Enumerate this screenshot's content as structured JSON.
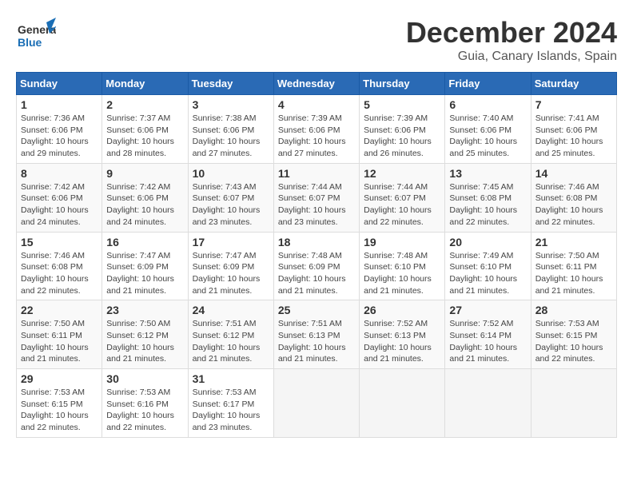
{
  "logo": {
    "line1": "General",
    "line2": "Blue"
  },
  "header": {
    "month": "December 2024",
    "location": "Guia, Canary Islands, Spain"
  },
  "weekdays": [
    "Sunday",
    "Monday",
    "Tuesday",
    "Wednesday",
    "Thursday",
    "Friday",
    "Saturday"
  ],
  "weeks": [
    [
      {
        "day": "1",
        "sunrise": "7:36 AM",
        "sunset": "6:06 PM",
        "daylight": "10 hours and 29 minutes."
      },
      {
        "day": "2",
        "sunrise": "7:37 AM",
        "sunset": "6:06 PM",
        "daylight": "10 hours and 28 minutes."
      },
      {
        "day": "3",
        "sunrise": "7:38 AM",
        "sunset": "6:06 PM",
        "daylight": "10 hours and 27 minutes."
      },
      {
        "day": "4",
        "sunrise": "7:39 AM",
        "sunset": "6:06 PM",
        "daylight": "10 hours and 27 minutes."
      },
      {
        "day": "5",
        "sunrise": "7:39 AM",
        "sunset": "6:06 PM",
        "daylight": "10 hours and 26 minutes."
      },
      {
        "day": "6",
        "sunrise": "7:40 AM",
        "sunset": "6:06 PM",
        "daylight": "10 hours and 25 minutes."
      },
      {
        "day": "7",
        "sunrise": "7:41 AM",
        "sunset": "6:06 PM",
        "daylight": "10 hours and 25 minutes."
      }
    ],
    [
      {
        "day": "8",
        "sunrise": "7:42 AM",
        "sunset": "6:06 PM",
        "daylight": "10 hours and 24 minutes."
      },
      {
        "day": "9",
        "sunrise": "7:42 AM",
        "sunset": "6:06 PM",
        "daylight": "10 hours and 24 minutes."
      },
      {
        "day": "10",
        "sunrise": "7:43 AM",
        "sunset": "6:07 PM",
        "daylight": "10 hours and 23 minutes."
      },
      {
        "day": "11",
        "sunrise": "7:44 AM",
        "sunset": "6:07 PM",
        "daylight": "10 hours and 23 minutes."
      },
      {
        "day": "12",
        "sunrise": "7:44 AM",
        "sunset": "6:07 PM",
        "daylight": "10 hours and 22 minutes."
      },
      {
        "day": "13",
        "sunrise": "7:45 AM",
        "sunset": "6:08 PM",
        "daylight": "10 hours and 22 minutes."
      },
      {
        "day": "14",
        "sunrise": "7:46 AM",
        "sunset": "6:08 PM",
        "daylight": "10 hours and 22 minutes."
      }
    ],
    [
      {
        "day": "15",
        "sunrise": "7:46 AM",
        "sunset": "6:08 PM",
        "daylight": "10 hours and 22 minutes."
      },
      {
        "day": "16",
        "sunrise": "7:47 AM",
        "sunset": "6:09 PM",
        "daylight": "10 hours and 21 minutes."
      },
      {
        "day": "17",
        "sunrise": "7:47 AM",
        "sunset": "6:09 PM",
        "daylight": "10 hours and 21 minutes."
      },
      {
        "day": "18",
        "sunrise": "7:48 AM",
        "sunset": "6:09 PM",
        "daylight": "10 hours and 21 minutes."
      },
      {
        "day": "19",
        "sunrise": "7:48 AM",
        "sunset": "6:10 PM",
        "daylight": "10 hours and 21 minutes."
      },
      {
        "day": "20",
        "sunrise": "7:49 AM",
        "sunset": "6:10 PM",
        "daylight": "10 hours and 21 minutes."
      },
      {
        "day": "21",
        "sunrise": "7:50 AM",
        "sunset": "6:11 PM",
        "daylight": "10 hours and 21 minutes."
      }
    ],
    [
      {
        "day": "22",
        "sunrise": "7:50 AM",
        "sunset": "6:11 PM",
        "daylight": "10 hours and 21 minutes."
      },
      {
        "day": "23",
        "sunrise": "7:50 AM",
        "sunset": "6:12 PM",
        "daylight": "10 hours and 21 minutes."
      },
      {
        "day": "24",
        "sunrise": "7:51 AM",
        "sunset": "6:12 PM",
        "daylight": "10 hours and 21 minutes."
      },
      {
        "day": "25",
        "sunrise": "7:51 AM",
        "sunset": "6:13 PM",
        "daylight": "10 hours and 21 minutes."
      },
      {
        "day": "26",
        "sunrise": "7:52 AM",
        "sunset": "6:13 PM",
        "daylight": "10 hours and 21 minutes."
      },
      {
        "day": "27",
        "sunrise": "7:52 AM",
        "sunset": "6:14 PM",
        "daylight": "10 hours and 21 minutes."
      },
      {
        "day": "28",
        "sunrise": "7:53 AM",
        "sunset": "6:15 PM",
        "daylight": "10 hours and 22 minutes."
      }
    ],
    [
      {
        "day": "29",
        "sunrise": "7:53 AM",
        "sunset": "6:15 PM",
        "daylight": "10 hours and 22 minutes."
      },
      {
        "day": "30",
        "sunrise": "7:53 AM",
        "sunset": "6:16 PM",
        "daylight": "10 hours and 22 minutes."
      },
      {
        "day": "31",
        "sunrise": "7:53 AM",
        "sunset": "6:17 PM",
        "daylight": "10 hours and 23 minutes."
      },
      null,
      null,
      null,
      null
    ]
  ]
}
